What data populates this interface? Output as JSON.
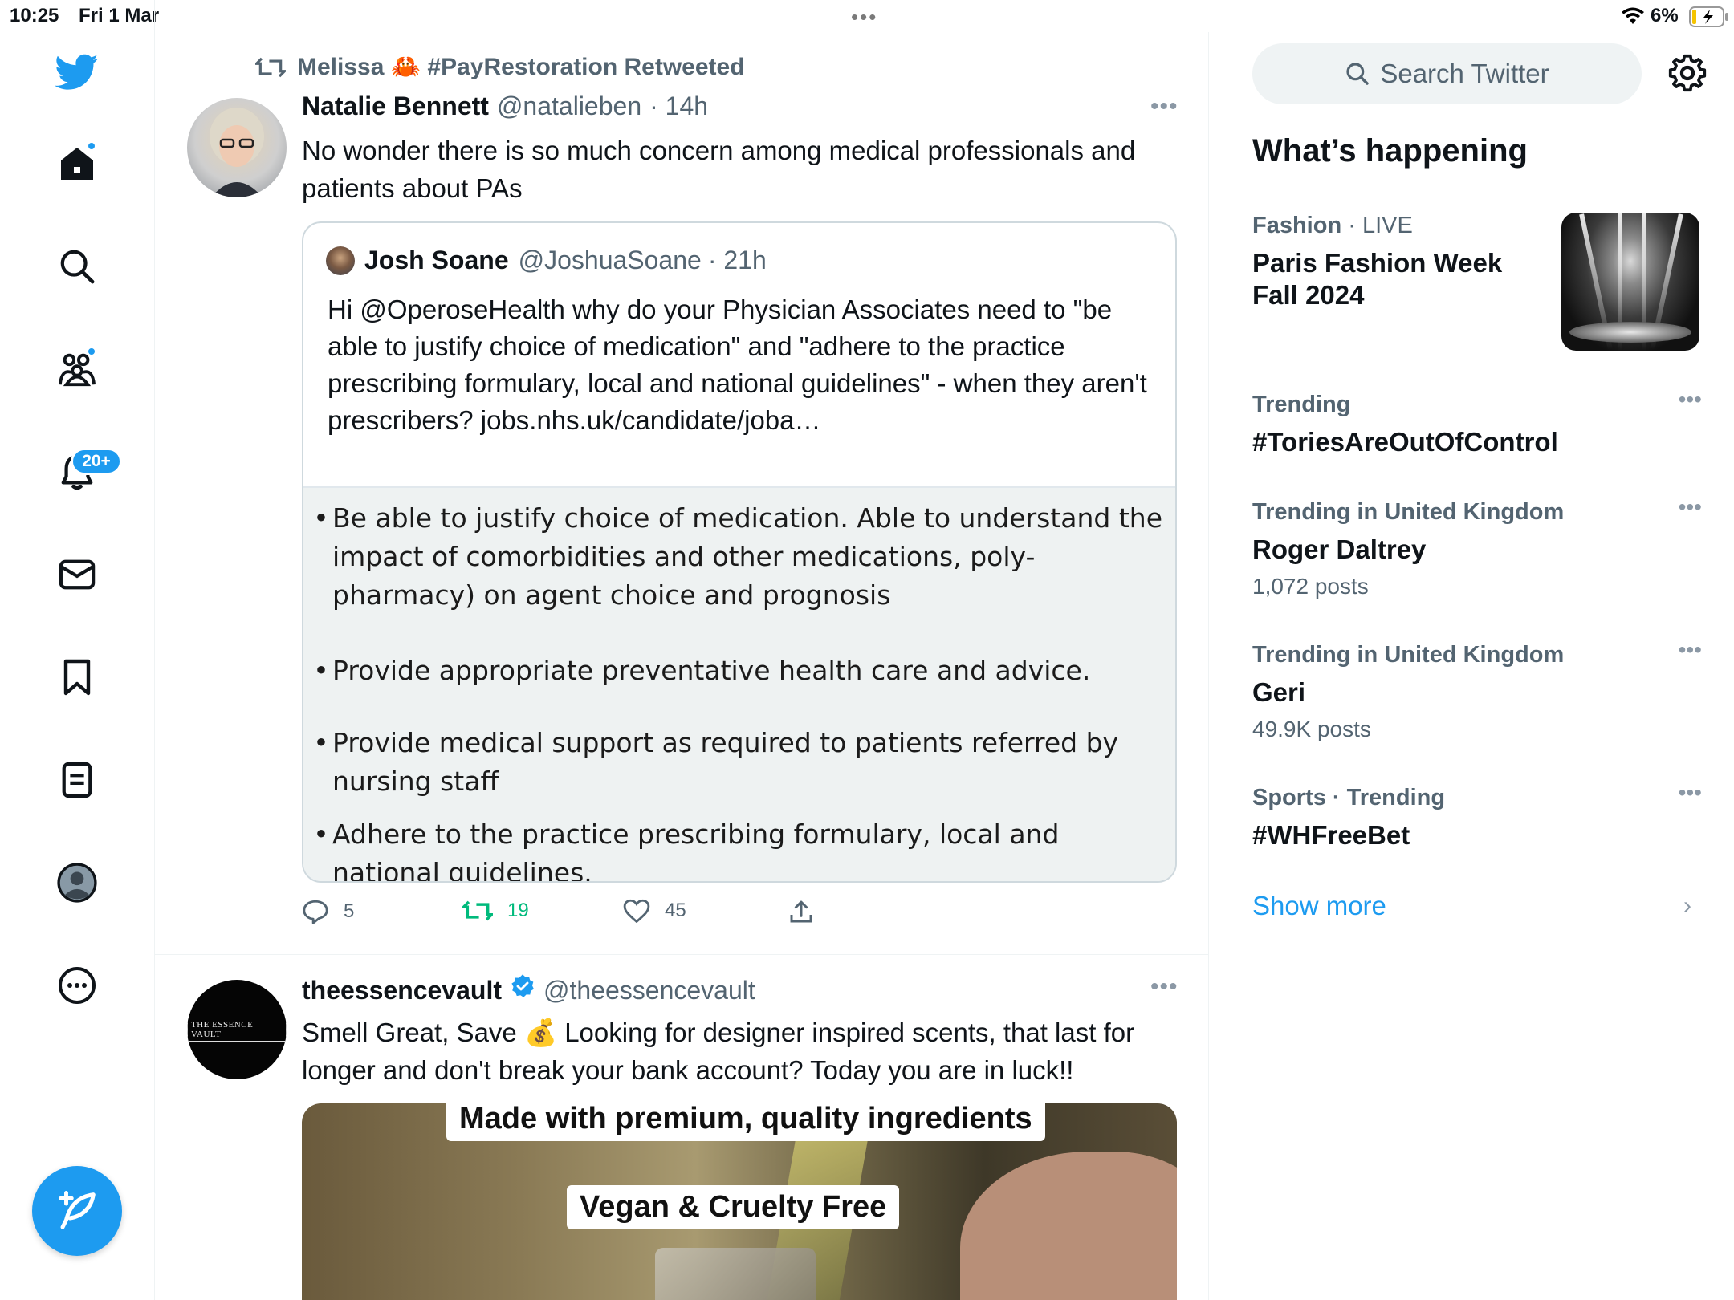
{
  "status_bar": {
    "time": "10:25",
    "date": "Fri 1 Mar",
    "battery_pct": "6%"
  },
  "nav": {
    "notifications_badge": "20+"
  },
  "colors": {
    "accent": "#1d9bf0",
    "retweet_green": "#00ba7c",
    "text_secondary": "#536471"
  },
  "tweet1": {
    "retweeted_by": "Melissa 🦀 #PayRestoration Retweeted",
    "name": "Natalie Bennett",
    "handle": "@natalieben",
    "time": "· 14h",
    "text": "No wonder there is so much concern among medical professionals and patients about PAs",
    "quote": {
      "name": "Josh Soane",
      "handle": "@JoshuaSoane",
      "time": "· 21h",
      "text": "Hi @OperoseHealth why do your Physician Associates need to \"be able to justify choice of medication\" and \"adhere to the practice prescribing formulary, local and national guidelines\" - when they aren't prescribers? jobs.nhs.uk/candidate/joba…",
      "bullets": [
        "Be able to justify choice of medication. Able to understand the impact of comorbidities and other medications, poly-pharmacy) on agent choice and prognosis",
        "Provide appropriate preventative health care and advice.",
        "Provide medical support as required to patients referred by nursing staff",
        "Adhere to the practice prescribing formulary, local and national guidelines."
      ]
    },
    "actions": {
      "replies": "5",
      "retweets": "19",
      "likes": "45"
    }
  },
  "tweet2": {
    "name": "theessencevault",
    "handle": "@theessencevault",
    "avatar_text": "THE ESSENCE VAULT",
    "text": "Smell Great, Save 💰 Looking for designer inspired scents, that last for longer and don't break your bank account? Today you are in luck!!",
    "media_captions": [
      "Made with premium, quality ingredients",
      "Vegan & Cruelty Free"
    ]
  },
  "right": {
    "search_placeholder": "Search Twitter",
    "title": "What’s happening",
    "trends": [
      {
        "meta_bold": "Fashion",
        "meta": " · LIVE",
        "title": "Paris Fashion Week Fall 2024",
        "sub": ""
      },
      {
        "meta_bold": "Trending",
        "meta": "",
        "title": "#ToriesAreOutOfControl",
        "sub": ""
      },
      {
        "meta_bold": "Trending in United Kingdom",
        "meta": "",
        "title": "Roger Daltrey",
        "sub": "1,072 posts"
      },
      {
        "meta_bold": "Trending in United Kingdom",
        "meta": "",
        "title": "Geri",
        "sub": "49.9K posts"
      },
      {
        "meta_bold": "Sports · Trending",
        "meta": "",
        "title": "#WHFreeBet",
        "sub": ""
      }
    ],
    "show_more": "Show more"
  }
}
